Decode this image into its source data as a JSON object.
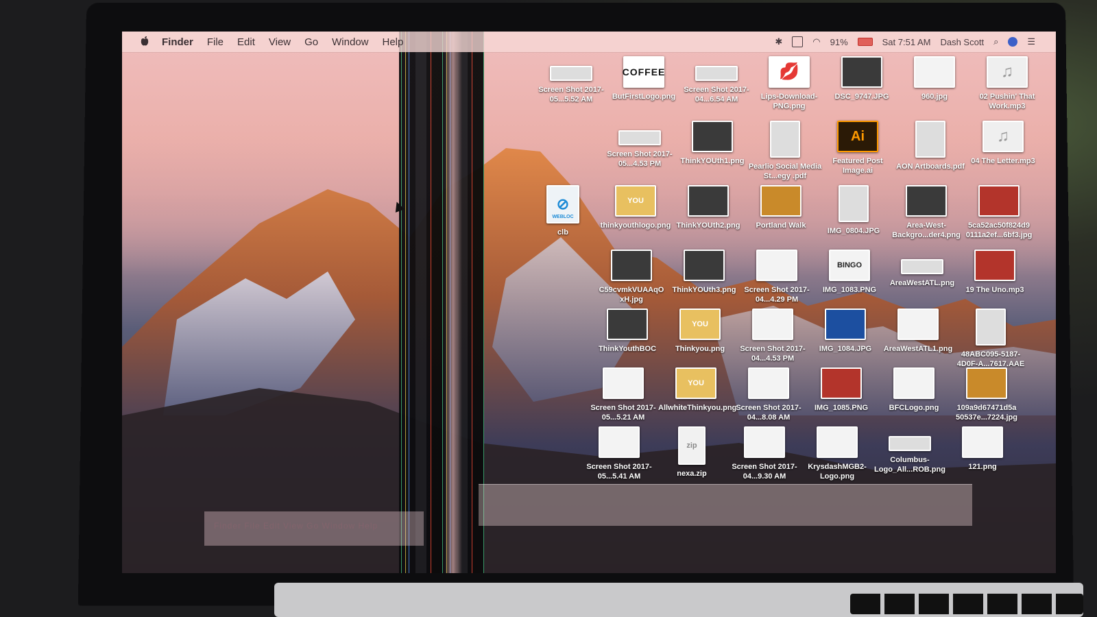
{
  "menubar": {
    "app_name": "Finder",
    "items": [
      "File",
      "Edit",
      "View",
      "Go",
      "Window",
      "Help"
    ],
    "status": {
      "battery": "91%",
      "datetime": "Sat 7:51 AM",
      "user": "Dash Scott"
    }
  },
  "ghost_menubar": "Finder   File   Edit   View   Go   Window   Help",
  "icons": [
    {
      "label": "Screen Shot 2017-05...5.52 AM",
      "kind": "wide"
    },
    {
      "label": "ButFirstLogo.png",
      "kind": "coffee",
      "glyph": "COFFEE"
    },
    {
      "label": "Screen Shot 2017-04...6.54 AM",
      "kind": "wide"
    },
    {
      "label": "Lips-Download-PNG.png",
      "kind": "lips",
      "glyph": "💋"
    },
    {
      "label": "DSC_9747.JPG",
      "kind": "dark"
    },
    {
      "label": "960.jpg",
      "kind": "blank"
    },
    {
      "label": "02 Pushin' That Work.mp3",
      "kind": "music",
      "glyph": "♫"
    },
    {
      "label": "Screen Shot 2017-05...4.53 PM",
      "kind": "wide"
    },
    {
      "label": "ThinkYOUth1.png",
      "kind": "dark"
    },
    {
      "label": "Pearlio Social Media St...egy .pdf",
      "kind": "doc"
    },
    {
      "label": "Featured Post Image.ai",
      "kind": "ai",
      "glyph": "Ai"
    },
    {
      "label": "AON Artboards.pdf",
      "kind": "doc"
    },
    {
      "label": "04 The Letter.mp3",
      "kind": "music",
      "glyph": "♫"
    },
    {
      "label": "clb",
      "kind": "safari",
      "glyph": "⊘"
    },
    {
      "label": "thinkyouthlogo.png",
      "kind": "gold",
      "glyph": "YOU"
    },
    {
      "label": "ThinkYOUth2.png",
      "kind": "dark"
    },
    {
      "label": "Portland Walk",
      "kind": "orange"
    },
    {
      "label": "IMG_0804.JPG",
      "kind": "doc"
    },
    {
      "label": "Area-West-Backgro...der4.png",
      "kind": "dark"
    },
    {
      "label": "5ca52ac50f824d9 0111a2ef...6bf3.jpg",
      "kind": "red"
    },
    {
      "label": "C59cvmkVUAAqO xH.jpg",
      "kind": "dark"
    },
    {
      "label": "ThinkYOUth3.png",
      "kind": "dark"
    },
    {
      "label": "Screen Shot 2017-04...4.29 PM",
      "kind": "blank"
    },
    {
      "label": "IMG_1083.PNG",
      "kind": "blank",
      "glyph": "BINGO"
    },
    {
      "label": "AreaWestATL.png",
      "kind": "wide"
    },
    {
      "label": "19 The Uno.mp3",
      "kind": "red"
    },
    {
      "label": "ThinkYouthBOC",
      "kind": "dark"
    },
    {
      "label": "Thinkyou.png",
      "kind": "gold",
      "glyph": "YOU"
    },
    {
      "label": "Screen Shot 2017-04...4.53 PM",
      "kind": "blank"
    },
    {
      "label": "IMG_1084.JPG",
      "kind": "blue"
    },
    {
      "label": "AreaWestATL1.png",
      "kind": "blank"
    },
    {
      "label": "48ABC095-5187-4D0F-A...7617.AAE",
      "kind": "doc"
    },
    {
      "label": "Screen Shot 2017-05...5.21 AM",
      "kind": "blank"
    },
    {
      "label": "AllwhiteThinkyou.png",
      "kind": "gold",
      "glyph": "YOU"
    },
    {
      "label": "Screen Shot 2017-04...8.08 AM",
      "kind": "blank"
    },
    {
      "label": "IMG_1085.PNG",
      "kind": "red"
    },
    {
      "label": "BFCLogo.png",
      "kind": "blank"
    },
    {
      "label": "109a9d67471d5a 50537e...7224.jpg",
      "kind": "orange"
    },
    {
      "label": "Screen Shot 2017-05...5.41 AM",
      "kind": "blank"
    },
    {
      "label": "nexa.zip",
      "kind": "zip",
      "glyph": "zip"
    },
    {
      "label": "Screen Shot 2017-04...9.30 AM",
      "kind": "blank"
    },
    {
      "label": "KrysdashMGB2-Logo.png",
      "kind": "blank"
    },
    {
      "label": "Columbus-Logo_All...ROB.png",
      "kind": "wide"
    },
    {
      "label": "121.png",
      "kind": "blank"
    }
  ],
  "safari_badge": "WEBLOC"
}
